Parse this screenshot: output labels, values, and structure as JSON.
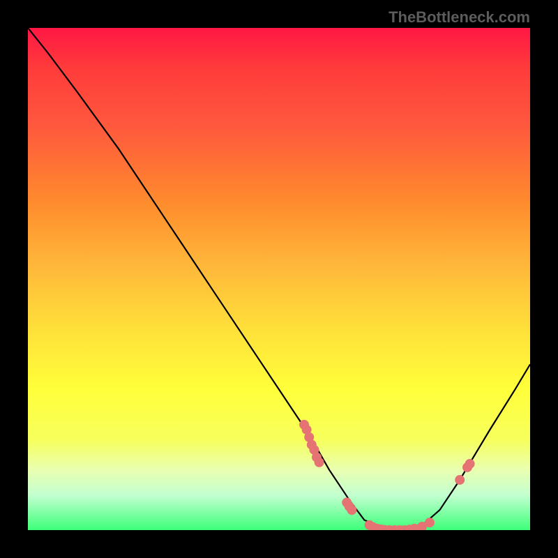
{
  "watermark": "TheBottleneck.com",
  "colors": {
    "curve": "#000000",
    "marker_fill": "#e57373",
    "marker_stroke": "#e57373"
  },
  "chart_data": {
    "type": "line",
    "title": "",
    "xlabel": "",
    "ylabel": "",
    "xlim": [
      0,
      100
    ],
    "ylim": [
      0,
      100
    ],
    "curve": {
      "x": [
        0,
        4,
        10,
        18,
        28,
        38,
        46,
        52,
        56,
        60,
        64,
        67,
        72,
        78,
        82,
        86,
        92,
        97,
        100
      ],
      "y": [
        100,
        95,
        87,
        76,
        61,
        46,
        34,
        25,
        19,
        12,
        6,
        2,
        0,
        0.5,
        4,
        10,
        20,
        28,
        33
      ]
    },
    "markers": [
      {
        "x": 55.0,
        "y": 21.0
      },
      {
        "x": 55.5,
        "y": 20.0
      },
      {
        "x": 56.0,
        "y": 18.5
      },
      {
        "x": 56.5,
        "y": 17.0
      },
      {
        "x": 57.0,
        "y": 16.0
      },
      {
        "x": 57.5,
        "y": 14.5
      },
      {
        "x": 58.0,
        "y": 13.5
      },
      {
        "x": 63.5,
        "y": 5.5
      },
      {
        "x": 64.0,
        "y": 4.7
      },
      {
        "x": 64.5,
        "y": 4.0
      },
      {
        "x": 68.0,
        "y": 1.0
      },
      {
        "x": 68.7,
        "y": 0.6
      },
      {
        "x": 69.5,
        "y": 0.3
      },
      {
        "x": 70.3,
        "y": 0.15
      },
      {
        "x": 71.0,
        "y": 0.05
      },
      {
        "x": 72.0,
        "y": 0.0
      },
      {
        "x": 73.0,
        "y": 0.0
      },
      {
        "x": 74.0,
        "y": 0.0
      },
      {
        "x": 75.0,
        "y": 0.0
      },
      {
        "x": 76.0,
        "y": 0.1
      },
      {
        "x": 77.0,
        "y": 0.3
      },
      {
        "x": 78.5,
        "y": 0.7
      },
      {
        "x": 80.0,
        "y": 1.5
      },
      {
        "x": 86.0,
        "y": 10.0
      },
      {
        "x": 87.5,
        "y": 12.5
      },
      {
        "x": 88.0,
        "y": 13.2
      }
    ],
    "marker_radius_y_units": 0.9
  }
}
